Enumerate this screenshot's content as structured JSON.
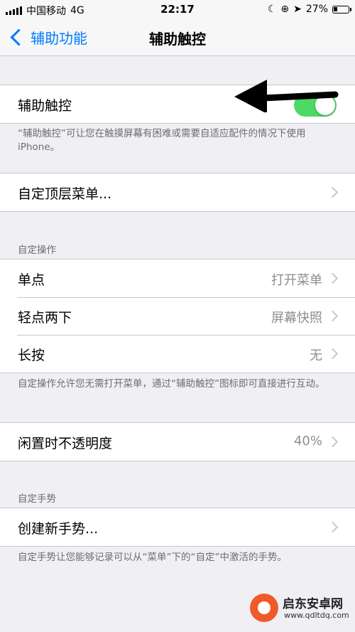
{
  "status_bar": {
    "carrier": "中国移动",
    "network": "4G",
    "time": "22:17",
    "battery": "27%",
    "battery_level": 0.27
  },
  "nav": {
    "back_label": "辅助功能",
    "title": "辅助触控"
  },
  "assistive_touch": {
    "label": "辅助触控",
    "toggle_on": true,
    "footer": "“辅助触控”可让您在触摸屏幕有困难或需要自适应配件的情况下使用 iPhone。"
  },
  "top_menu": {
    "label": "自定顶层菜单..."
  },
  "custom_actions": {
    "header": "自定操作",
    "rows": [
      {
        "label": "单点",
        "value": "打开菜单"
      },
      {
        "label": "轻点两下",
        "value": "屏幕快照"
      },
      {
        "label": "长按",
        "value": "无"
      }
    ],
    "footer": "自定操作允许您无需打开菜单，通过“辅助触控”图标即可直接进行互动。"
  },
  "idle_opacity": {
    "label": "闲置时不透明度",
    "value": "40%"
  },
  "custom_gestures": {
    "header": "自定手势",
    "create_label": "创建新手势...",
    "footer": "自定手势让您能够记录可以从“菜单”下的“自定”中激活的手势。"
  },
  "watermark": {
    "name": "启东安卓网",
    "url": "www.qdltdq.com"
  },
  "colors": {
    "accent": "#007aff",
    "toggle_on": "#4cd964",
    "background": "#efeff4"
  }
}
